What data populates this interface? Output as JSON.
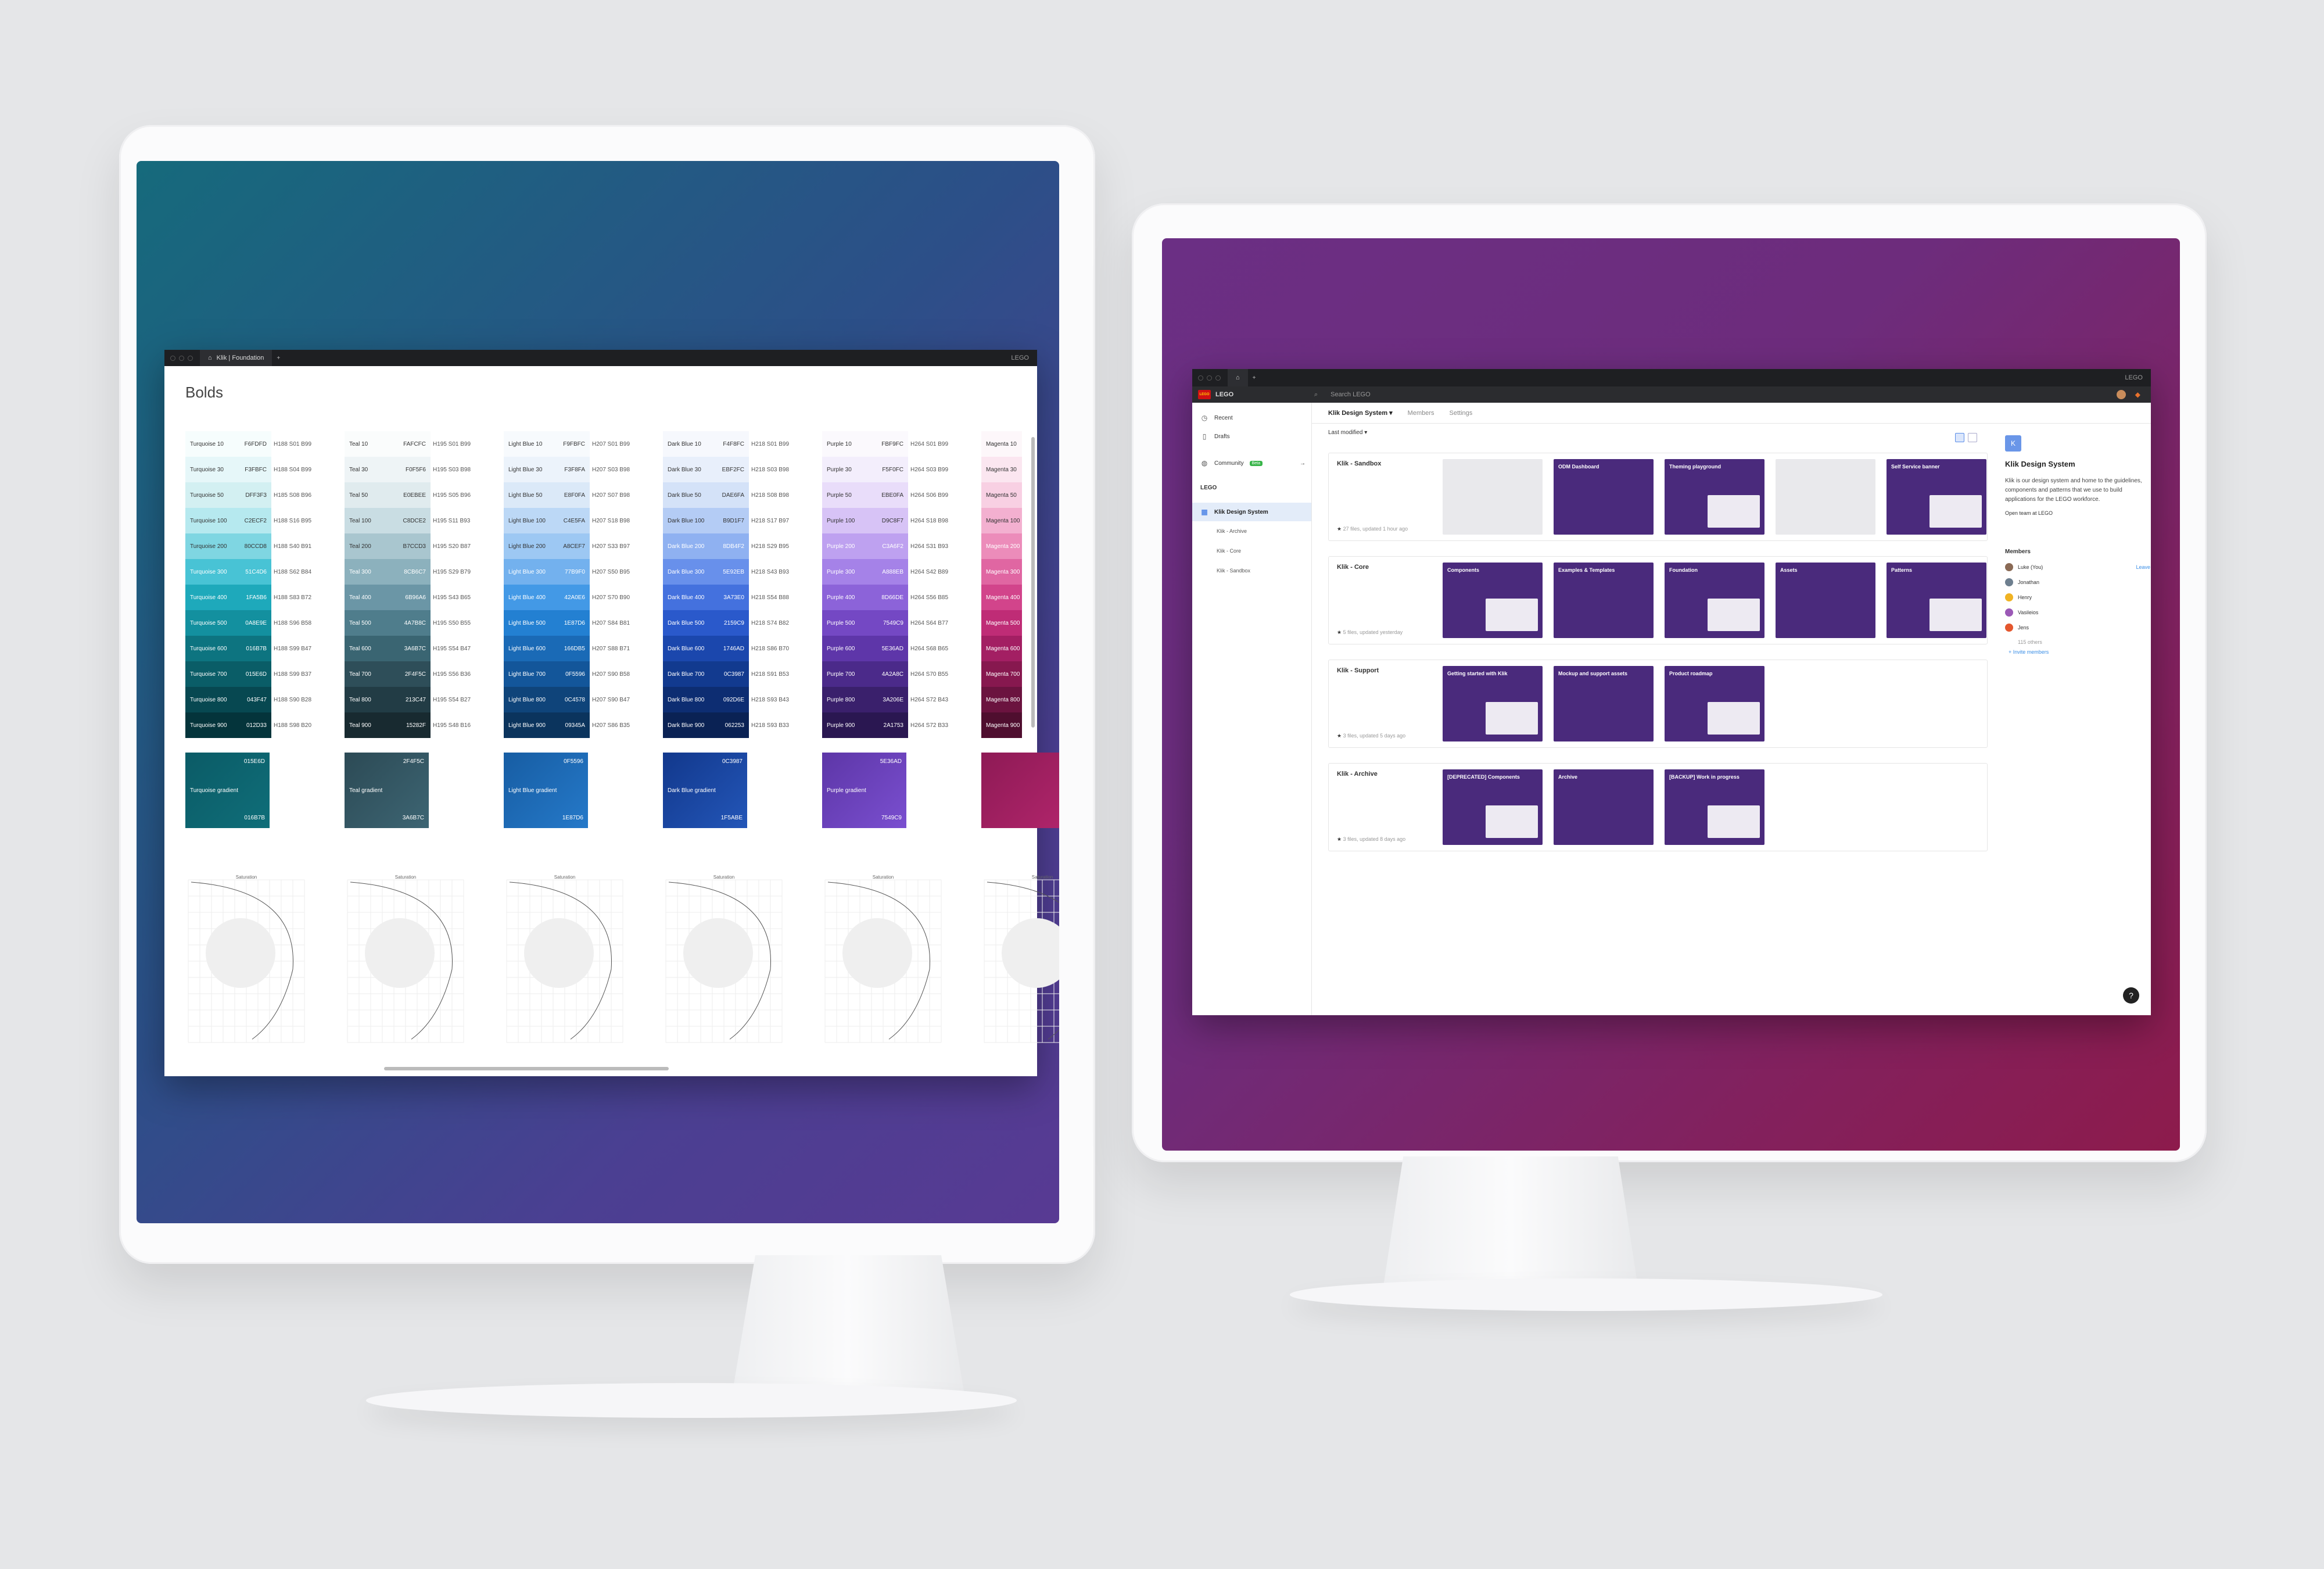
{
  "left_window": {
    "tab_title": "Klik | Foundation",
    "brand": "LEGO",
    "heading": "Bolds",
    "columns": [
      {
        "color_family": "turquoise",
        "swatches": [
          {
            "name": "Turquoise 10",
            "hex": "F6FDFD",
            "hsb": "H188 S01 B99",
            "bg": "#f6fdfd",
            "fg": "#333"
          },
          {
            "name": "Turquoise 30",
            "hex": "F3FBFC",
            "hsb": "H188 S04 B99",
            "bg": "#e6f7f9",
            "fg": "#333"
          },
          {
            "name": "Turquoise 50",
            "hex": "DFF3F3",
            "hsb": "H185 S08 B96",
            "bg": "#d3f0f2",
            "fg": "#333"
          },
          {
            "name": "Turquoise 100",
            "hex": "C2ECF2",
            "hsb": "H188 S16 B95",
            "bg": "#b6e9ef",
            "fg": "#333"
          },
          {
            "name": "Turquoise 200",
            "hex": "80CCD8",
            "hsb": "H188 S40 B91",
            "bg": "#7fd6e2",
            "fg": "#333"
          },
          {
            "name": "Turquoise 300",
            "hex": "51C4D6",
            "hsb": "H188 S62 B84",
            "bg": "#48c3d5",
            "fg": "#fff"
          },
          {
            "name": "Turquoise 400",
            "hex": "1FA5B6",
            "hsb": "H188 S83 B72",
            "bg": "#1ea9bb",
            "fg": "#fff"
          },
          {
            "name": "Turquoise 500",
            "hex": "0A8E9E",
            "hsb": "H188 S96 B58",
            "bg": "#13909f",
            "fg": "#fff"
          },
          {
            "name": "Turquoise 600",
            "hex": "016B7B",
            "hsb": "H188 S99 B47",
            "bg": "#0d7480",
            "fg": "#fff"
          },
          {
            "name": "Turquoise 700",
            "hex": "015E6D",
            "hsb": "H188 S99 B37",
            "bg": "#0a5d67",
            "fg": "#fff"
          },
          {
            "name": "Turquoise 800",
            "hex": "043F47",
            "hsb": "H188 S90 B28",
            "bg": "#074851",
            "fg": "#fff"
          },
          {
            "name": "Turquoise 900",
            "hex": "012D33",
            "hsb": "H188 S98 B20",
            "bg": "#04343b",
            "fg": "#fff"
          }
        ],
        "gradient": {
          "name": "Turquoise gradient",
          "from": "015E6D",
          "to": "016B7B",
          "css": "linear-gradient(135deg,#0b5b66,#0f6e79)"
        }
      },
      {
        "color_family": "teal",
        "swatches": [
          {
            "name": "Teal 10",
            "hex": "FAFCFC",
            "hsb": "H195 S01 B99",
            "bg": "#fafcfc",
            "fg": "#333"
          },
          {
            "name": "Teal 30",
            "hex": "F0F5F6",
            "hsb": "H195 S03 B98",
            "bg": "#eef4f6",
            "fg": "#333"
          },
          {
            "name": "Teal 50",
            "hex": "E0EBEE",
            "hsb": "H195 S05 B96",
            "bg": "#e0ebee",
            "fg": "#333"
          },
          {
            "name": "Teal 100",
            "hex": "C8DCE2",
            "hsb": "H195 S11 B93",
            "bg": "#c9dde3",
            "fg": "#333"
          },
          {
            "name": "Teal 200",
            "hex": "B7CCD3",
            "hsb": "H195 S20 B87",
            "bg": "#a9c6cf",
            "fg": "#333"
          },
          {
            "name": "Teal 300",
            "hex": "8CB6C7",
            "hsb": "H195 S29 B79",
            "bg": "#8cb1bd",
            "fg": "#fff"
          },
          {
            "name": "Teal 400",
            "hex": "6B96A6",
            "hsb": "H195 S43 B65",
            "bg": "#6b96a6",
            "fg": "#fff"
          },
          {
            "name": "Teal 500",
            "hex": "4A7B8C",
            "hsb": "H195 S50 B55",
            "bg": "#4f7d8c",
            "fg": "#fff"
          },
          {
            "name": "Teal 600",
            "hex": "3A6B7C",
            "hsb": "H195 S54 B47",
            "bg": "#3a6572",
            "fg": "#fff"
          },
          {
            "name": "Teal 700",
            "hex": "2F4F5C",
            "hsb": "H195 S56 B36",
            "bg": "#2e4e59",
            "fg": "#fff"
          },
          {
            "name": "Teal 800",
            "hex": "213C47",
            "hsb": "H195 S54 B27",
            "bg": "#223c45",
            "fg": "#fff"
          },
          {
            "name": "Teal 900",
            "hex": "15282F",
            "hsb": "H195 S48 B16",
            "bg": "#182a30",
            "fg": "#fff"
          }
        ],
        "gradient": {
          "name": "Teal gradient",
          "from": "2F4F5C",
          "to": "3A6B7C",
          "css": "linear-gradient(135deg,#2c4a55,#3d6573)"
        }
      },
      {
        "color_family": "light-blue",
        "swatches": [
          {
            "name": "Light Blue 10",
            "hex": "F9FBFC",
            "hsb": "H207 S01 B99",
            "bg": "#f7fafd",
            "fg": "#333"
          },
          {
            "name": "Light Blue 30",
            "hex": "F3F8FA",
            "hsb": "H207 S03 B98",
            "bg": "#ecf3fb",
            "fg": "#333"
          },
          {
            "name": "Light Blue 50",
            "hex": "E8F0FA",
            "hsb": "H207 S07 B98",
            "bg": "#dbe9f8",
            "fg": "#333"
          },
          {
            "name": "Light Blue 100",
            "hex": "C4E5FA",
            "hsb": "H207 S18 B98",
            "bg": "#bcd8f6",
            "fg": "#333"
          },
          {
            "name": "Light Blue 200",
            "hex": "A8CEF7",
            "hsb": "H207 S33 B97",
            "bg": "#9dc8f3",
            "fg": "#333"
          },
          {
            "name": "Light Blue 300",
            "hex": "77B9F0",
            "hsb": "H207 S50 B95",
            "bg": "#73b1ee",
            "fg": "#fff"
          },
          {
            "name": "Light Blue 400",
            "hex": "42A0E6",
            "hsb": "H207 S70 B90",
            "bg": "#4399e6",
            "fg": "#fff"
          },
          {
            "name": "Light Blue 500",
            "hex": "1E87D6",
            "hsb": "H207 S84 B81",
            "bg": "#2380d2",
            "fg": "#fff"
          },
          {
            "name": "Light Blue 600",
            "hex": "166DB5",
            "hsb": "H207 S88 B71",
            "bg": "#1a6ab6",
            "fg": "#fff"
          },
          {
            "name": "Light Blue 700",
            "hex": "0F5596",
            "hsb": "H207 S90 B58",
            "bg": "#13569a",
            "fg": "#fff"
          },
          {
            "name": "Light Blue 800",
            "hex": "0C4578",
            "hsb": "H207 S90 B47",
            "bg": "#0f447a",
            "fg": "#fff"
          },
          {
            "name": "Light Blue 900",
            "hex": "09345A",
            "hsb": "H207 S86 B35",
            "bg": "#0b345d",
            "fg": "#fff"
          }
        ],
        "gradient": {
          "name": "Light Blue gradient",
          "from": "0F5596",
          "to": "1E87D6",
          "css": "linear-gradient(135deg,#175da3,#2579c9)"
        }
      },
      {
        "color_family": "dark-blue",
        "swatches": [
          {
            "name": "Dark Blue 10",
            "hex": "F4F8FC",
            "hsb": "H218 S01 B99",
            "bg": "#f6f8fd",
            "fg": "#333"
          },
          {
            "name": "Dark Blue 30",
            "hex": "EBF2FC",
            "hsb": "H218 S03 B98",
            "bg": "#e8effb",
            "fg": "#333"
          },
          {
            "name": "Dark Blue 50",
            "hex": "DAE6FA",
            "hsb": "H218 S08 B98",
            "bg": "#d4e2f8",
            "fg": "#333"
          },
          {
            "name": "Dark Blue 100",
            "hex": "B9D1F7",
            "hsb": "H218 S17 B97",
            "bg": "#b4ccf5",
            "fg": "#333"
          },
          {
            "name": "Dark Blue 200",
            "hex": "8DB4F2",
            "hsb": "H218 S29 B95",
            "bg": "#8fb1f1",
            "fg": "#fff"
          },
          {
            "name": "Dark Blue 300",
            "hex": "5E92EB",
            "hsb": "H218 S43 B93",
            "bg": "#6890eb",
            "fg": "#fff"
          },
          {
            "name": "Dark Blue 400",
            "hex": "3A73E0",
            "hsb": "H218 S54 B88",
            "bg": "#4471de",
            "fg": "#fff"
          },
          {
            "name": "Dark Blue 500",
            "hex": "2159C9",
            "hsb": "H218 S74 B82",
            "bg": "#2a59cb",
            "fg": "#fff"
          },
          {
            "name": "Dark Blue 600",
            "hex": "1746AD",
            "hsb": "H218 S86 B70",
            "bg": "#1b47ad",
            "fg": "#fff"
          },
          {
            "name": "Dark Blue 700",
            "hex": "0C3987",
            "hsb": "H218 S91 B53",
            "bg": "#123a8f",
            "fg": "#fff"
          },
          {
            "name": "Dark Blue 800",
            "hex": "092D6E",
            "hsb": "H218 S93 B43",
            "bg": "#0d2d72",
            "fg": "#fff"
          },
          {
            "name": "Dark Blue 900",
            "hex": "062253",
            "hsb": "H218 S93 B33",
            "bg": "#0a2254",
            "fg": "#fff"
          }
        ],
        "gradient": {
          "name": "Dark Blue gradient",
          "from": "0C3987",
          "to": "1F5ABE",
          "css": "linear-gradient(135deg,#12388c,#2356b8)"
        }
      },
      {
        "color_family": "purple",
        "swatches": [
          {
            "name": "Purple 10",
            "hex": "FBF9FC",
            "hsb": "H264 S01 B99",
            "bg": "#fbf9fd",
            "fg": "#333"
          },
          {
            "name": "Purple 30",
            "hex": "F5F0FC",
            "hsb": "H264 S03 B99",
            "bg": "#f3eefc",
            "fg": "#333"
          },
          {
            "name": "Purple 50",
            "hex": "EBE0FA",
            "hsb": "H264 S06 B99",
            "bg": "#e9ddfa",
            "fg": "#333"
          },
          {
            "name": "Purple 100",
            "hex": "D9C8F7",
            "hsb": "H264 S18 B98",
            "bg": "#d7c3f6",
            "fg": "#333"
          },
          {
            "name": "Purple 200",
            "hex": "C3A6F2",
            "hsb": "H264 S31 B93",
            "bg": "#bea1f0",
            "fg": "#fff"
          },
          {
            "name": "Purple 300",
            "hex": "A888EB",
            "hsb": "H264 S42 B89",
            "bg": "#a582e8",
            "fg": "#fff"
          },
          {
            "name": "Purple 400",
            "hex": "8D66DE",
            "hsb": "H264 S56 B85",
            "bg": "#8c63d9",
            "fg": "#fff"
          },
          {
            "name": "Purple 500",
            "hex": "7549C9",
            "hsb": "H264 S64 B77",
            "bg": "#7448c4",
            "fg": "#fff"
          },
          {
            "name": "Purple 600",
            "hex": "5E36AD",
            "hsb": "H264 S68 B65",
            "bg": "#5e36a9",
            "fg": "#fff"
          },
          {
            "name": "Purple 700",
            "hex": "4A2A8C",
            "hsb": "H264 S70 B55",
            "bg": "#4b2a8a",
            "fg": "#fff"
          },
          {
            "name": "Purple 800",
            "hex": "3A206E",
            "hsb": "H264 S72 B43",
            "bg": "#3a206c",
            "fg": "#fff"
          },
          {
            "name": "Purple 900",
            "hex": "2A1753",
            "hsb": "H264 S72 B33",
            "bg": "#2a1751",
            "fg": "#fff"
          }
        ],
        "gradient": {
          "name": "Purple gradient",
          "from": "5E36AD",
          "to": "7549C9",
          "css": "linear-gradient(135deg,#5d36a7,#7a4fd0)"
        }
      },
      {
        "color_family": "magenta",
        "swatches": [
          {
            "name": "Magenta 10",
            "hex": "",
            "hsb": "",
            "bg": "#fdf7fa",
            "fg": "#333"
          },
          {
            "name": "Magenta 30",
            "hex": "",
            "hsb": "",
            "bg": "#fbe6f0",
            "fg": "#333"
          },
          {
            "name": "Magenta 50",
            "hex": "",
            "hsb": "",
            "bg": "#f8d0e3",
            "fg": "#333"
          },
          {
            "name": "Magenta 100",
            "hex": "",
            "hsb": "",
            "bg": "#f3b0d0",
            "fg": "#333"
          },
          {
            "name": "Magenta 200",
            "hex": "",
            "hsb": "",
            "bg": "#ec8cba",
            "fg": "#fff"
          },
          {
            "name": "Magenta 300",
            "hex": "",
            "hsb": "",
            "bg": "#e066a2",
            "fg": "#fff"
          },
          {
            "name": "Magenta 400",
            "hex": "",
            "hsb": "",
            "bg": "#d2448b",
            "fg": "#fff"
          },
          {
            "name": "Magenta 500",
            "hex": "",
            "hsb": "",
            "bg": "#bf2c76",
            "fg": "#fff"
          },
          {
            "name": "Magenta 600",
            "hex": "",
            "hsb": "",
            "bg": "#a31f63",
            "fg": "#fff"
          },
          {
            "name": "Magenta 700",
            "hex": "",
            "hsb": "",
            "bg": "#87184f",
            "fg": "#fff"
          },
          {
            "name": "Magenta 800",
            "hex": "",
            "hsb": "",
            "bg": "#6b133f",
            "fg": "#fff"
          },
          {
            "name": "Magenta 900",
            "hex": "",
            "hsb": "",
            "bg": "#4f0e2f",
            "fg": "#fff"
          }
        ],
        "gradient": {
          "name": "",
          "from": "",
          "to": "",
          "css": "linear-gradient(135deg,#8e1a55,#b0256b)"
        }
      }
    ],
    "plot_labels": {
      "x": "Saturation",
      "y": "Brightness",
      "min": "0",
      "max": "100"
    }
  },
  "right_window": {
    "brand": "LEGO",
    "search_placeholder": "Search LEGO",
    "sidebar": {
      "recent": "Recent",
      "drafts": "Drafts",
      "community": "Community",
      "beta": "Beta",
      "team": "LEGO",
      "projects": [
        {
          "label": "Klik Design System",
          "selected": true
        },
        {
          "label": "Klik - Archive",
          "selected": false
        },
        {
          "label": "Klik - Core",
          "selected": false
        },
        {
          "label": "Klik - Sandbox",
          "selected": false
        }
      ]
    },
    "subnav": {
      "title": "Klik Design System ▾",
      "members": "Members",
      "settings": "Settings"
    },
    "sort_label": "Last modified ▾",
    "projects": [
      {
        "title": "Klik - Sandbox",
        "meta": "27 files, updated 1 hour ago",
        "files": [
          {
            "title": "",
            "light": true
          },
          {
            "title": "ODM Dashboard",
            "light": false
          },
          {
            "title": "Theming playground",
            "light": false
          },
          {
            "title": "",
            "light": true
          },
          {
            "title": "Self Service banner",
            "light": false
          }
        ]
      },
      {
        "title": "Klik - Core",
        "meta": "5 files, updated yesterday",
        "files": [
          {
            "title": "Components",
            "light": false
          },
          {
            "title": "Examples & Templates",
            "light": false
          },
          {
            "title": "Foundation",
            "light": false
          },
          {
            "title": "Assets",
            "light": false
          },
          {
            "title": "Patterns",
            "light": false
          }
        ]
      },
      {
        "title": "Klik - Support",
        "meta": "3 files, updated 5 days ago",
        "files": [
          {
            "title": "Getting started with Klik",
            "light": false
          },
          {
            "title": "Mockup and support assets",
            "light": false
          },
          {
            "title": "Product roadmap",
            "light": false
          }
        ]
      },
      {
        "title": "Klik - Archive",
        "meta": "3 files, updated 8 days ago",
        "files": [
          {
            "title": "[DEPRECATED] Components",
            "light": false
          },
          {
            "title": "Archive",
            "light": false
          },
          {
            "title": "[BACKUP] Work in progress",
            "light": false
          }
        ]
      }
    ],
    "detail": {
      "initial": "K",
      "title": "Klik Design System",
      "description": "Klik is our design system and home to the guidelines, components and patterns that we use to build applications for the LEGO workforce.",
      "open_team": "Open team at LEGO",
      "members_heading": "Members",
      "members": [
        {
          "name": "Luke (You)",
          "color": "#8a6a55"
        },
        {
          "name": "Jonathan",
          "color": "#6e7f8f"
        },
        {
          "name": "Henry",
          "color": "#f0b323"
        },
        {
          "name": "Vasileios",
          "color": "#9b59b6"
        },
        {
          "name": "Jens",
          "color": "#e4572e"
        }
      ],
      "leave": "Leave",
      "others": "115 others",
      "invite": "+ Invite members"
    },
    "help": "?"
  }
}
